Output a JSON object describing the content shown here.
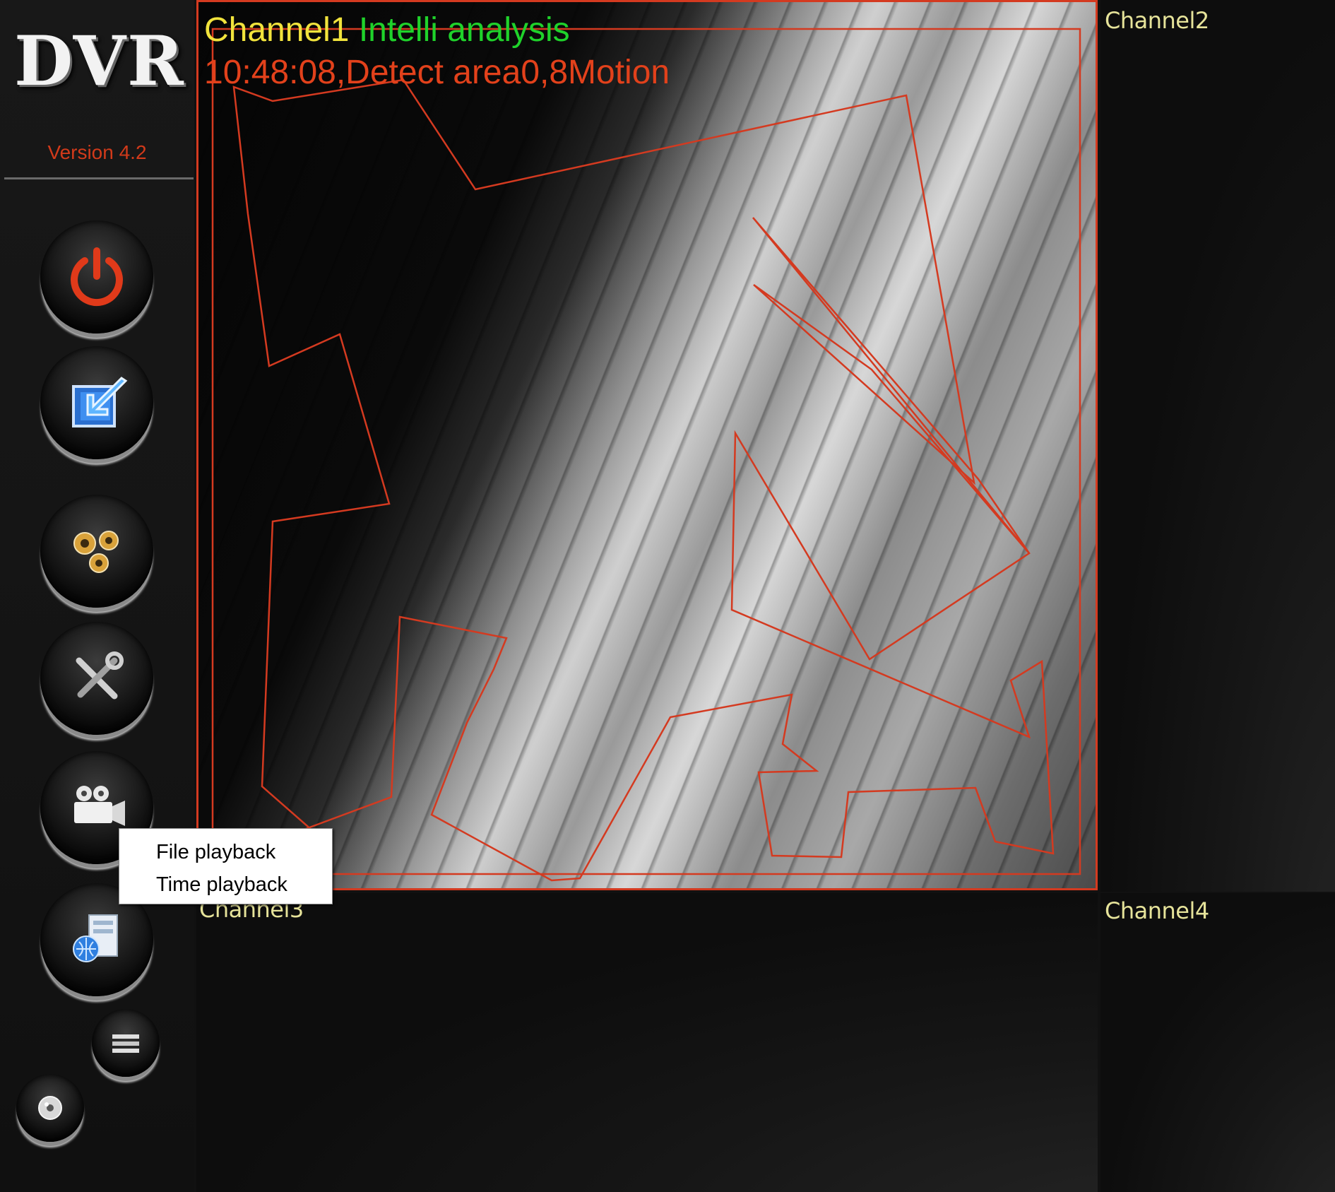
{
  "sidebar": {
    "logo": "DVR",
    "version": "Version 4.2",
    "buttons": [
      {
        "name": "power-button",
        "icon": "power-icon"
      },
      {
        "name": "login-button",
        "icon": "login-arrow-icon"
      },
      {
        "name": "settings-button",
        "icon": "gears-icon"
      },
      {
        "name": "tools-button",
        "icon": "tools-icon"
      },
      {
        "name": "playback-button",
        "icon": "camera-icon"
      },
      {
        "name": "network-button",
        "icon": "network-computer-icon"
      },
      {
        "name": "list-button",
        "icon": "list-icon"
      },
      {
        "name": "record-button",
        "icon": "disc-icon"
      }
    ]
  },
  "channels": {
    "ch1": {
      "label": "Channel1",
      "mode": "Intelli analysis",
      "status": "10:48:08,Detect area0,8Motion"
    },
    "ch2": {
      "label": "Channel2"
    },
    "ch3": {
      "label": "Channel3"
    },
    "ch4": {
      "label": "Channel4"
    }
  },
  "context_menu": {
    "items": [
      "File playback",
      "Time playback"
    ]
  },
  "colors": {
    "channel_label": "#e6e39a",
    "channel1_title": "#f1e33c",
    "intelli_analysis": "#1fd22b",
    "motion_status": "#e2411b",
    "detect_area_outline": "#d43a20",
    "version_text": "#d23a1a"
  }
}
